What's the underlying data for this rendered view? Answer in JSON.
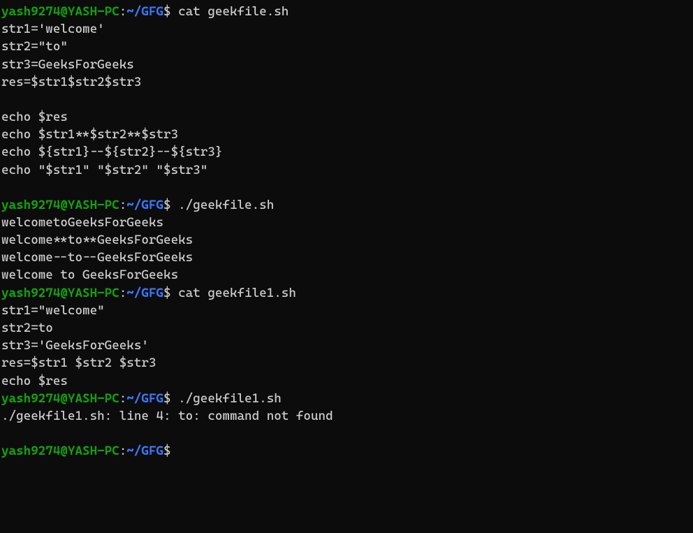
{
  "prompts": {
    "user": "yash9274@YASH-PC",
    "colon": ":",
    "path": "~/GFG",
    "dollar": "$"
  },
  "lines": [
    {
      "type": "prompt",
      "command": " cat geekfile.sh"
    },
    {
      "type": "output",
      "text": "str1='welcome'"
    },
    {
      "type": "output",
      "text": "str2=\"to\""
    },
    {
      "type": "output",
      "text": "str3=GeeksForGeeks"
    },
    {
      "type": "output",
      "text": "res=$str1$str2$str3"
    },
    {
      "type": "output",
      "text": ""
    },
    {
      "type": "output",
      "text": "echo $res"
    },
    {
      "type": "output",
      "text": "echo $str1**$str2**$str3"
    },
    {
      "type": "output",
      "text": "echo ${str1}--${str2}--${str3}"
    },
    {
      "type": "output",
      "text": "echo \"$str1\" \"$str2\" \"$str3\""
    },
    {
      "type": "output",
      "text": ""
    },
    {
      "type": "prompt",
      "command": " ./geekfile.sh"
    },
    {
      "type": "output",
      "text": "welcometoGeeksForGeeks"
    },
    {
      "type": "output",
      "text": "welcome**to**GeeksForGeeks"
    },
    {
      "type": "output",
      "text": "welcome--to--GeeksForGeeks"
    },
    {
      "type": "output",
      "text": "welcome to GeeksForGeeks"
    },
    {
      "type": "prompt",
      "command": " cat geekfile1.sh"
    },
    {
      "type": "output",
      "text": "str1=\"welcome\""
    },
    {
      "type": "output",
      "text": "str2=to"
    },
    {
      "type": "output",
      "text": "str3='GeeksForGeeks'"
    },
    {
      "type": "output",
      "text": "res=$str1 $str2 $str3"
    },
    {
      "type": "output",
      "text": "echo $res"
    },
    {
      "type": "prompt",
      "command": " ./geekfile1.sh"
    },
    {
      "type": "output",
      "text": "./geekfile1.sh: line 4: to: command not found"
    },
    {
      "type": "output",
      "text": ""
    },
    {
      "type": "prompt",
      "command": ""
    }
  ]
}
